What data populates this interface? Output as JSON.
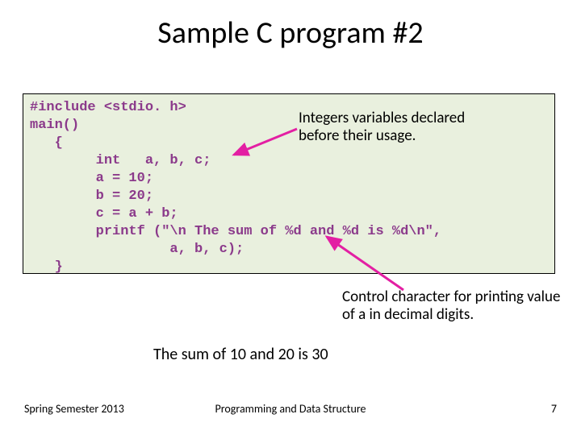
{
  "title": "Sample C program #2",
  "code_lines": [
    "#include <stdio. h>",
    "main()",
    "   {",
    "        int   a, b, c;",
    "        a = 10;",
    "        b = 20;",
    "        c = a + b;",
    "        printf (\"\\n The sum of %d and %d is %d\\n\",",
    "                 a, b, c);",
    "   }"
  ],
  "annotation1": "Integers variables declared before their usage.",
  "annotation2": "Control character for printing value of a in decimal digits.",
  "output_line": "The sum of 10 and 20 is 30",
  "footer": {
    "left": "Spring Semester 2013",
    "center": "Programming and Data Structure",
    "right": "7"
  },
  "colors": {
    "code_bg": "#e9f0de",
    "code_fg": "#8b3a8b",
    "arrow": "#e31fa3"
  }
}
